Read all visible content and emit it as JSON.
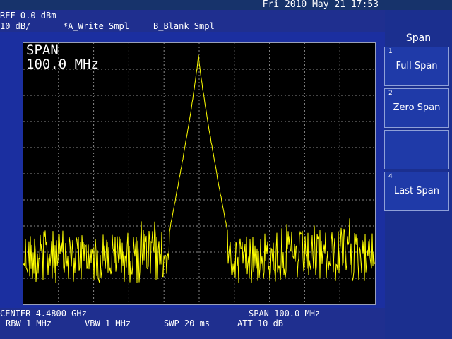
{
  "status_bar": {
    "datetime": "Fri 2010 May 21 17:53"
  },
  "header": {
    "ref_level": "REF 0.0 dBm",
    "scale": "10 dB/",
    "trace_a": "*A_Write Smpl",
    "trace_b": "B_Blank Smpl"
  },
  "display": {
    "span_title": "SPAN",
    "span_value": "100.0 MHz"
  },
  "footer": {
    "center": "CENTER 4.4800 GHz",
    "span": "SPAN 100.0 MHz",
    "rbw": "RBW 1 MHz",
    "vbw": "VBW 1 MHz",
    "sweep": "SWP 20 ms",
    "att": "ATT 10 dB"
  },
  "menu": {
    "title": "Span",
    "keys": [
      {
        "number": "1",
        "label": "Full Span"
      },
      {
        "number": "2",
        "label": "Zero Span"
      },
      {
        "number": "",
        "label": ""
      },
      {
        "number": "4",
        "label": "Last Span"
      }
    ]
  },
  "colors": {
    "trace": "#ffff00",
    "grid": "#8a8a8a",
    "background": "#000000"
  }
}
